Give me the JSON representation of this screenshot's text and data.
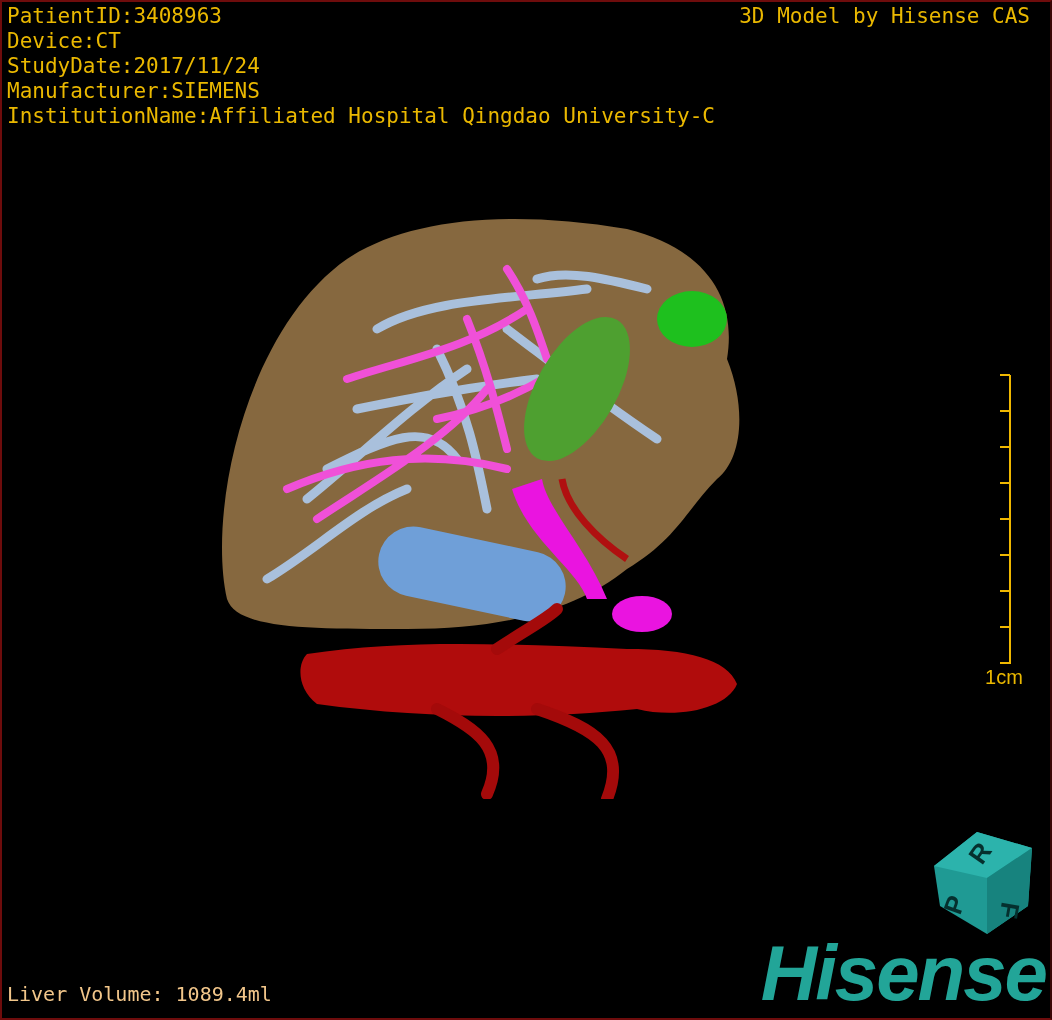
{
  "header": {
    "info_lines": [
      "PatientID:3408963",
      "Device:CT",
      "StudyDate:2017/11/24",
      "Manufacturer:SIEMENS",
      "InstitutionName:Affiliated Hospital Qingdao University-C"
    ],
    "title": "3D Model by Hisense CAS"
  },
  "viewport": {
    "scale_bar": {
      "label": "1cm"
    },
    "orientation_cube": {
      "faces": [
        "P",
        "R",
        "F"
      ]
    }
  },
  "footer": {
    "liver_volume": "Liver Volume: 1089.4ml",
    "logo": "Hisense"
  }
}
